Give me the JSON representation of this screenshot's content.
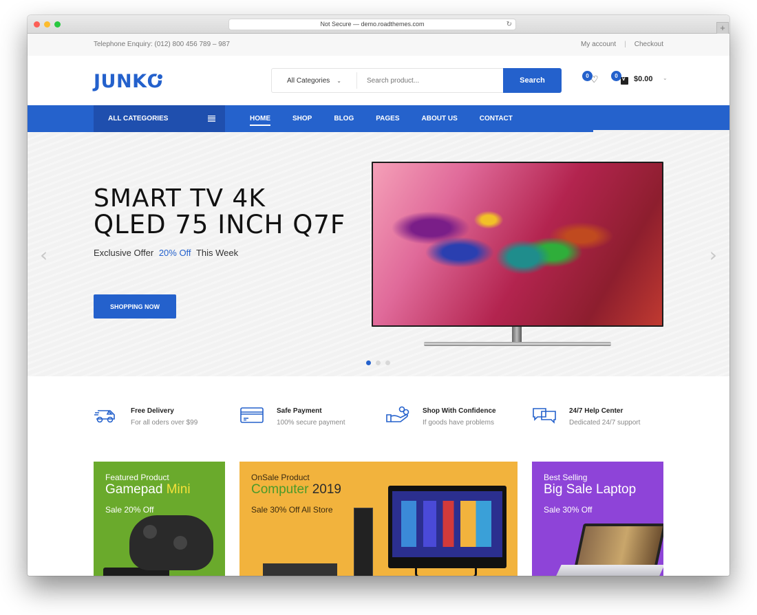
{
  "browser": {
    "url_text": "Not Secure — demo.roadthemes.com",
    "reload_icon": "reload-icon",
    "new_tab_icon": "plus-icon",
    "new_tab_label": "+"
  },
  "topbar": {
    "phone": "Telephone Enquiry: (012) 800 456 789 – 987",
    "links": [
      "My account",
      "Checkout"
    ],
    "separator": "|"
  },
  "header": {
    "logo_prefix": "JUNK",
    "logo_last": "O",
    "category_select": "All Categories",
    "category_chevron": "⌄",
    "search_placeholder": "Search product...",
    "search_button": "Search",
    "wishlist_count": "0",
    "wishlist_icon": "♡",
    "cart_count": "0",
    "cart_total": "$0.00",
    "cart_chevron": "⌄"
  },
  "nav": {
    "all_categories": "ALL CATEGORIES",
    "items": [
      {
        "label": "HOME",
        "active": true
      },
      {
        "label": "SHOP",
        "active": false
      },
      {
        "label": "BLOG",
        "active": false
      },
      {
        "label": "PAGES",
        "active": false
      },
      {
        "label": "ABOUT US",
        "active": false
      },
      {
        "label": "CONTACT",
        "active": false
      }
    ]
  },
  "hero": {
    "title_line1": "SMART TV 4K",
    "title_line2": "QLED 75 INCH Q7F",
    "sub_prefix": "Exclusive Offer",
    "sub_highlight": "20% Off",
    "sub_suffix": "This Week",
    "button": "SHOPPING NOW",
    "prev_arrow": "‹",
    "next_arrow": "›",
    "slide_count": 3,
    "active_slide": 1
  },
  "features": [
    {
      "icon": "delivery-truck-icon",
      "title": "Free Delivery",
      "desc": "For all oders over $99"
    },
    {
      "icon": "credit-card-icon",
      "title": "Safe Payment",
      "desc": "100% secure payment"
    },
    {
      "icon": "hand-coins-icon",
      "title": "Shop With Confidence",
      "desc": "If goods have problems"
    },
    {
      "icon": "chat-bubbles-icon",
      "title": "24/7 Help Center",
      "desc": "Dedicated 24/7 support"
    }
  ],
  "banners": [
    {
      "kicker": "Featured Product",
      "head_main": "Gamepad",
      "head_accent": "Mini",
      "sale": "Sale 20% Off",
      "bg": "#6aaa2c"
    },
    {
      "kicker": "OnSale Product",
      "head_accent": "Computer",
      "head_main": "2019",
      "sale": "Sale 30% Off All Store",
      "bg": "#f2b33d"
    },
    {
      "kicker": "Best Selling",
      "head_main": "Big Sale Laptop",
      "sale": "Sale 30% Off",
      "bg": "#8e44d8"
    }
  ],
  "colors": {
    "brand_blue": "#2461cc",
    "nav_dark_blue": "#1f4fae"
  }
}
